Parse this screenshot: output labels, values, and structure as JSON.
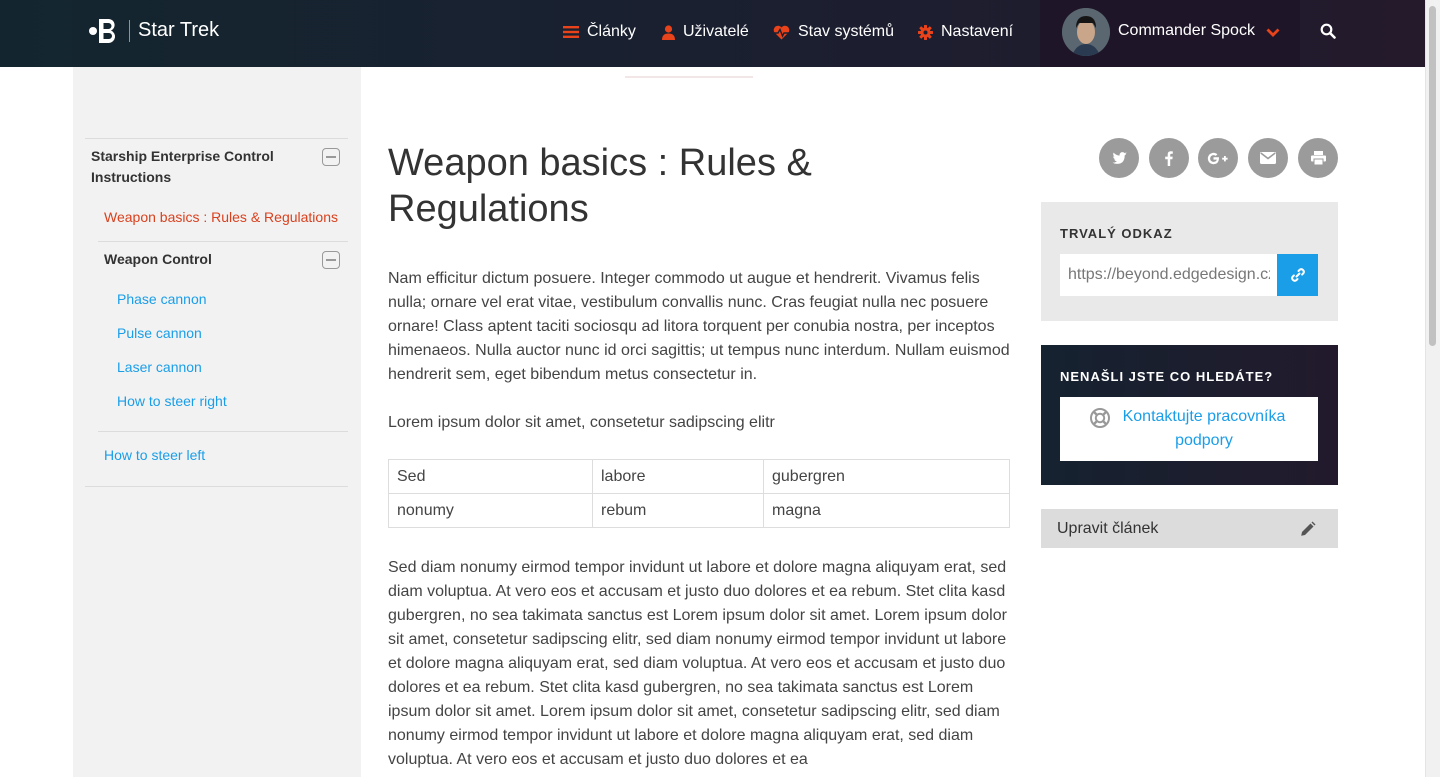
{
  "header": {
    "brand": "Star Trek",
    "nav": [
      {
        "label": "Články",
        "icon": "list-icon"
      },
      {
        "label": "Uživatelé",
        "icon": "user-icon"
      },
      {
        "label": "Stav systémů",
        "icon": "heartbeat-icon"
      },
      {
        "label": "Nastavení",
        "icon": "gear-icon"
      }
    ],
    "user": {
      "name": "Commander Spock"
    },
    "accent_color": "#e8431b"
  },
  "sidebar": {
    "section_title": "Starship Enterprise Control Instructions",
    "active_item": "Weapon basics : Rules & Regulations",
    "group_title": "Weapon Control",
    "subitems": [
      "Phase cannon",
      "Pulse cannon",
      "Laser cannon",
      "How to steer right"
    ],
    "other_item": "How to steer left"
  },
  "article": {
    "title": "Weapon basics : Rules & Regulations",
    "paragraph1": "Nam efficitur dictum posuere. Integer commodo ut augue et hendrerit. Vivamus felis nulla; ornare vel erat vitae, vestibulum convallis nunc. Cras feugiat nulla nec posuere ornare! Class aptent taciti sociosqu ad litora torquent per conubia nostra, per inceptos himenaeos. Nulla auctor nunc id orci sagittis; ut tempus nunc interdum. Nullam euismod hendrerit sem, eget bibendum metus consectetur in.",
    "paragraph2": "Lorem ipsum dolor sit amet, consetetur sadipscing elitr",
    "table": [
      [
        "Sed",
        "labore",
        "gubergren"
      ],
      [
        "nonumy",
        "rebum",
        "magna"
      ]
    ],
    "paragraph3": "Sed diam nonumy eirmod tempor invidunt ut labore et dolore magna aliquyam erat, sed diam voluptua. At vero eos et accusam et justo duo dolores et ea rebum. Stet clita kasd gubergren, no sea takimata sanctus est Lorem ipsum dolor sit amet. Lorem ipsum dolor sit amet, consetetur sadipscing elitr, sed diam nonumy eirmod tempor invidunt ut labore et dolore magna aliquyam erat, sed diam voluptua. At vero eos et accusam et justo duo dolores et ea rebum. Stet clita kasd gubergren, no sea takimata sanctus est Lorem ipsum dolor sit amet. Lorem ipsum dolor sit amet, consetetur sadipscing elitr, sed diam nonumy eirmod tempor invidunt ut labore et dolore magna aliquyam erat, sed diam voluptua. At vero eos et accusam et justo duo dolores et ea"
  },
  "right_panel": {
    "share_icons": [
      "twitter-icon",
      "facebook-icon",
      "google-plus-icon",
      "email-icon",
      "print-icon"
    ],
    "permalink": {
      "heading": "TRVALÝ ODKAZ",
      "value": "https://beyond.edgedesign.cz"
    },
    "help": {
      "heading": "NENAŠLI JSTE CO HLEDÁTE?",
      "button_label": "Kontaktujte pracovníka podpory"
    },
    "edit": {
      "label": "Upravit článek"
    },
    "link_color": "#1a9ee8"
  }
}
